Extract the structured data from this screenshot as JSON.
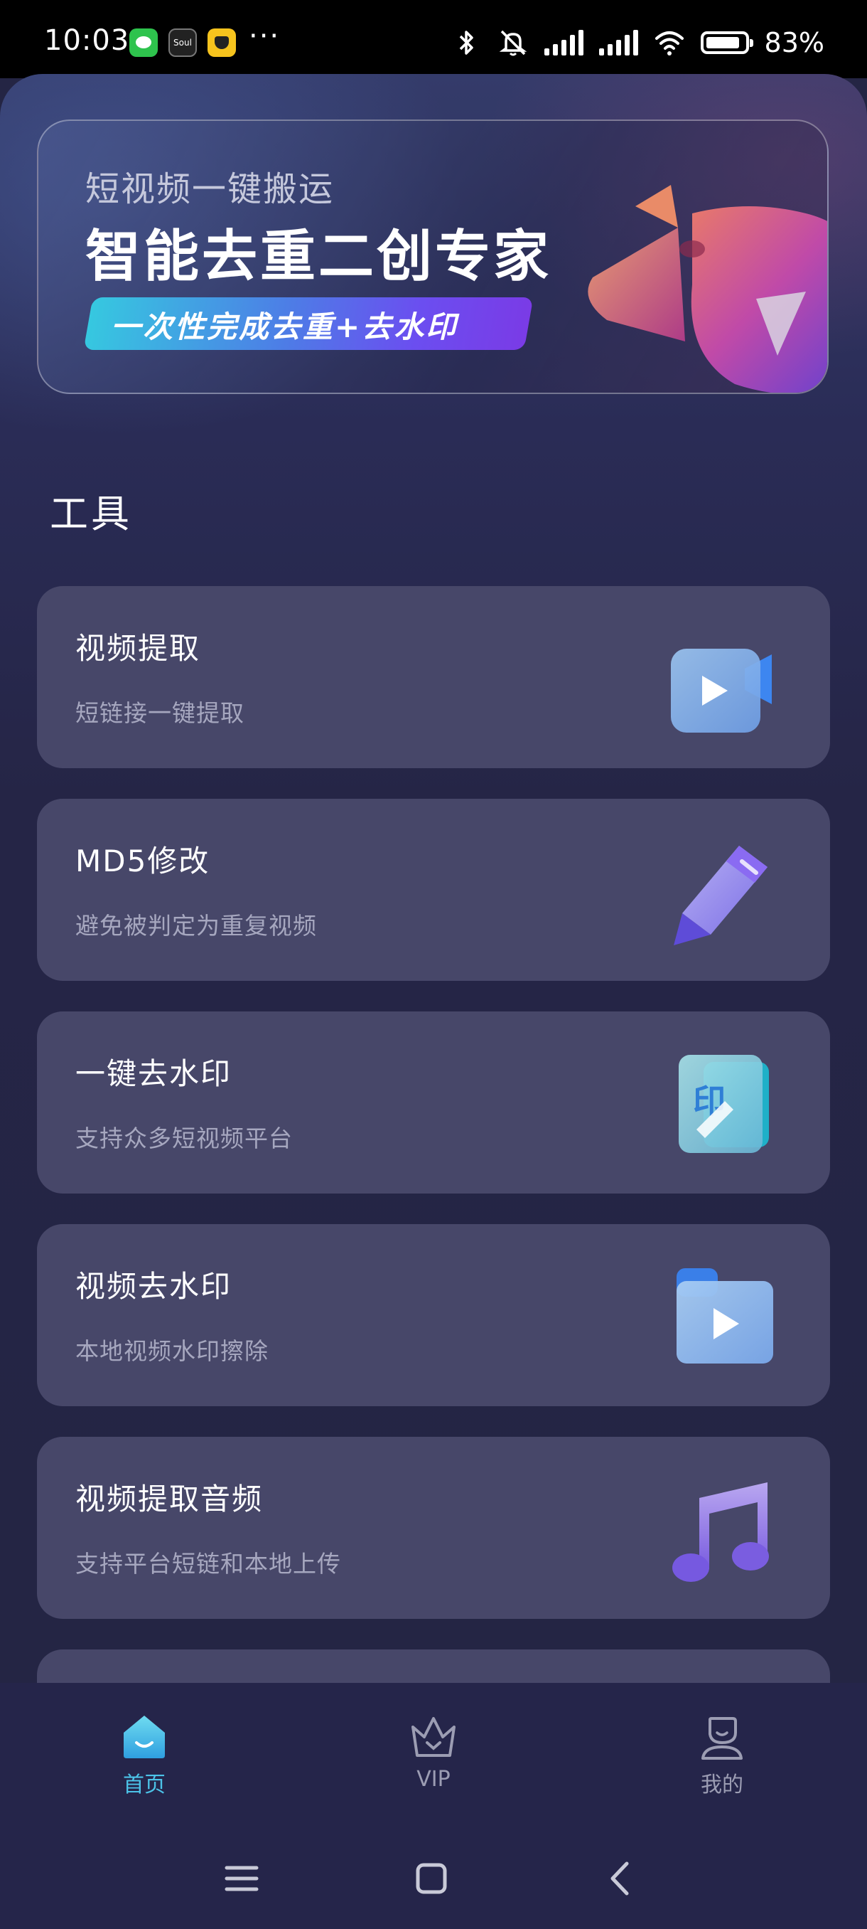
{
  "status_bar": {
    "time": "10:03",
    "soul_label": "Soul",
    "dots": "···",
    "battery_text": "83%",
    "icons": [
      "wechat-icon",
      "soul-icon",
      "qq-icon",
      "bluetooth-icon",
      "mute-icon",
      "signal-icon",
      "hd-signal-icon",
      "wifi-icon",
      "battery-icon"
    ]
  },
  "banner": {
    "subtitle": "短视频一键搬运",
    "title": "智能去重二创专家",
    "pill": "一次性完成去重+去水印",
    "art": "video-camera-3d-icon"
  },
  "section": {
    "title": "工具"
  },
  "tools": [
    {
      "title": "视频提取",
      "desc": "短链接一键提取",
      "icon": "video-camera-icon"
    },
    {
      "title": "MD5修改",
      "desc": "避免被判定为重复视频",
      "icon": "pencil-icon"
    },
    {
      "title": "一键去水印",
      "desc": "支持众多短视频平台",
      "icon": "stamp-icon",
      "icon_text": "印"
    },
    {
      "title": "视频去水印",
      "desc": "本地视频水印擦除",
      "icon": "video-folder-icon"
    },
    {
      "title": "视频提取音频",
      "desc": "支持平台短链和本地上传",
      "icon": "music-note-icon"
    }
  ],
  "bottom_nav": [
    {
      "label": "首页",
      "icon": "home-icon",
      "active": true
    },
    {
      "label": "VIP",
      "icon": "crown-icon",
      "active": false
    },
    {
      "label": "我的",
      "icon": "profile-icon",
      "active": false
    }
  ],
  "colors": {
    "background": "#242544",
    "card": "#474769",
    "accent": "#4cc3e8",
    "muted_text": "#a6a7bf"
  }
}
